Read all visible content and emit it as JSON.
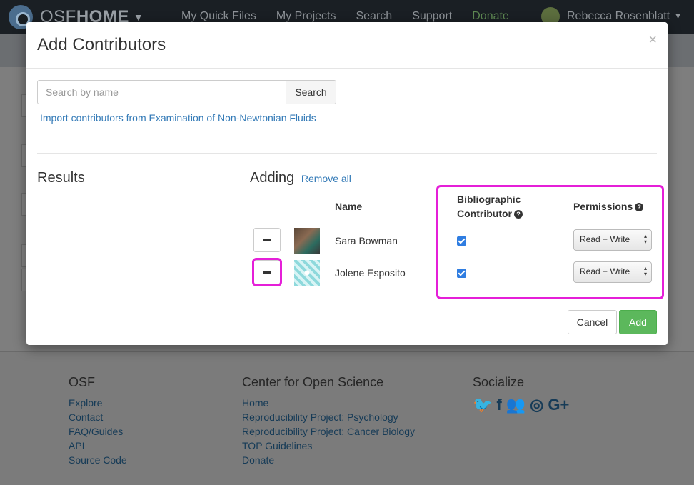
{
  "navbar": {
    "brand_prefix": "OSF",
    "brand_bold": "HOME",
    "links": [
      "My Quick Files",
      "My Projects",
      "Search",
      "Support",
      "Donate"
    ],
    "user_name": "Rebecca Rosenblatt"
  },
  "modal": {
    "title": "Add Contributors",
    "close_label": "×",
    "search_placeholder": "Search by name",
    "search_button": "Search",
    "import_link": "Import contributors from Examination of Non-Newtonian Fluids",
    "results_title": "Results",
    "adding_title": "Adding",
    "remove_all": "Remove all",
    "columns": {
      "name": "Name",
      "bibliographic": "Bibliographic Contributor",
      "permissions": "Permissions"
    },
    "contributors": [
      {
        "name": "Sara Bowman",
        "bibliographic": true,
        "permission": "Read + Write"
      },
      {
        "name": "Jolene Esposito",
        "bibliographic": true,
        "permission": "Read + Write"
      }
    ],
    "cancel_button": "Cancel",
    "add_button": "Add"
  },
  "footer": {
    "osf": {
      "title": "OSF",
      "links": [
        "Explore",
        "Contact",
        "FAQ/Guides",
        "API",
        "Source Code"
      ]
    },
    "cos": {
      "title": "Center for Open Science",
      "links": [
        "Home",
        "Reproducibility Project: Psychology",
        "Reproducibility Project: Cancer Biology",
        "TOP Guidelines",
        "Donate"
      ]
    },
    "socialize": {
      "title": "Socialize",
      "icons": [
        "twitter-icon",
        "facebook-icon",
        "group-icon",
        "github-icon",
        "google-plus-icon"
      ]
    }
  },
  "colors": {
    "highlight": "#e51fd8",
    "add_button": "#5cb85c",
    "link": "#337ab7"
  }
}
